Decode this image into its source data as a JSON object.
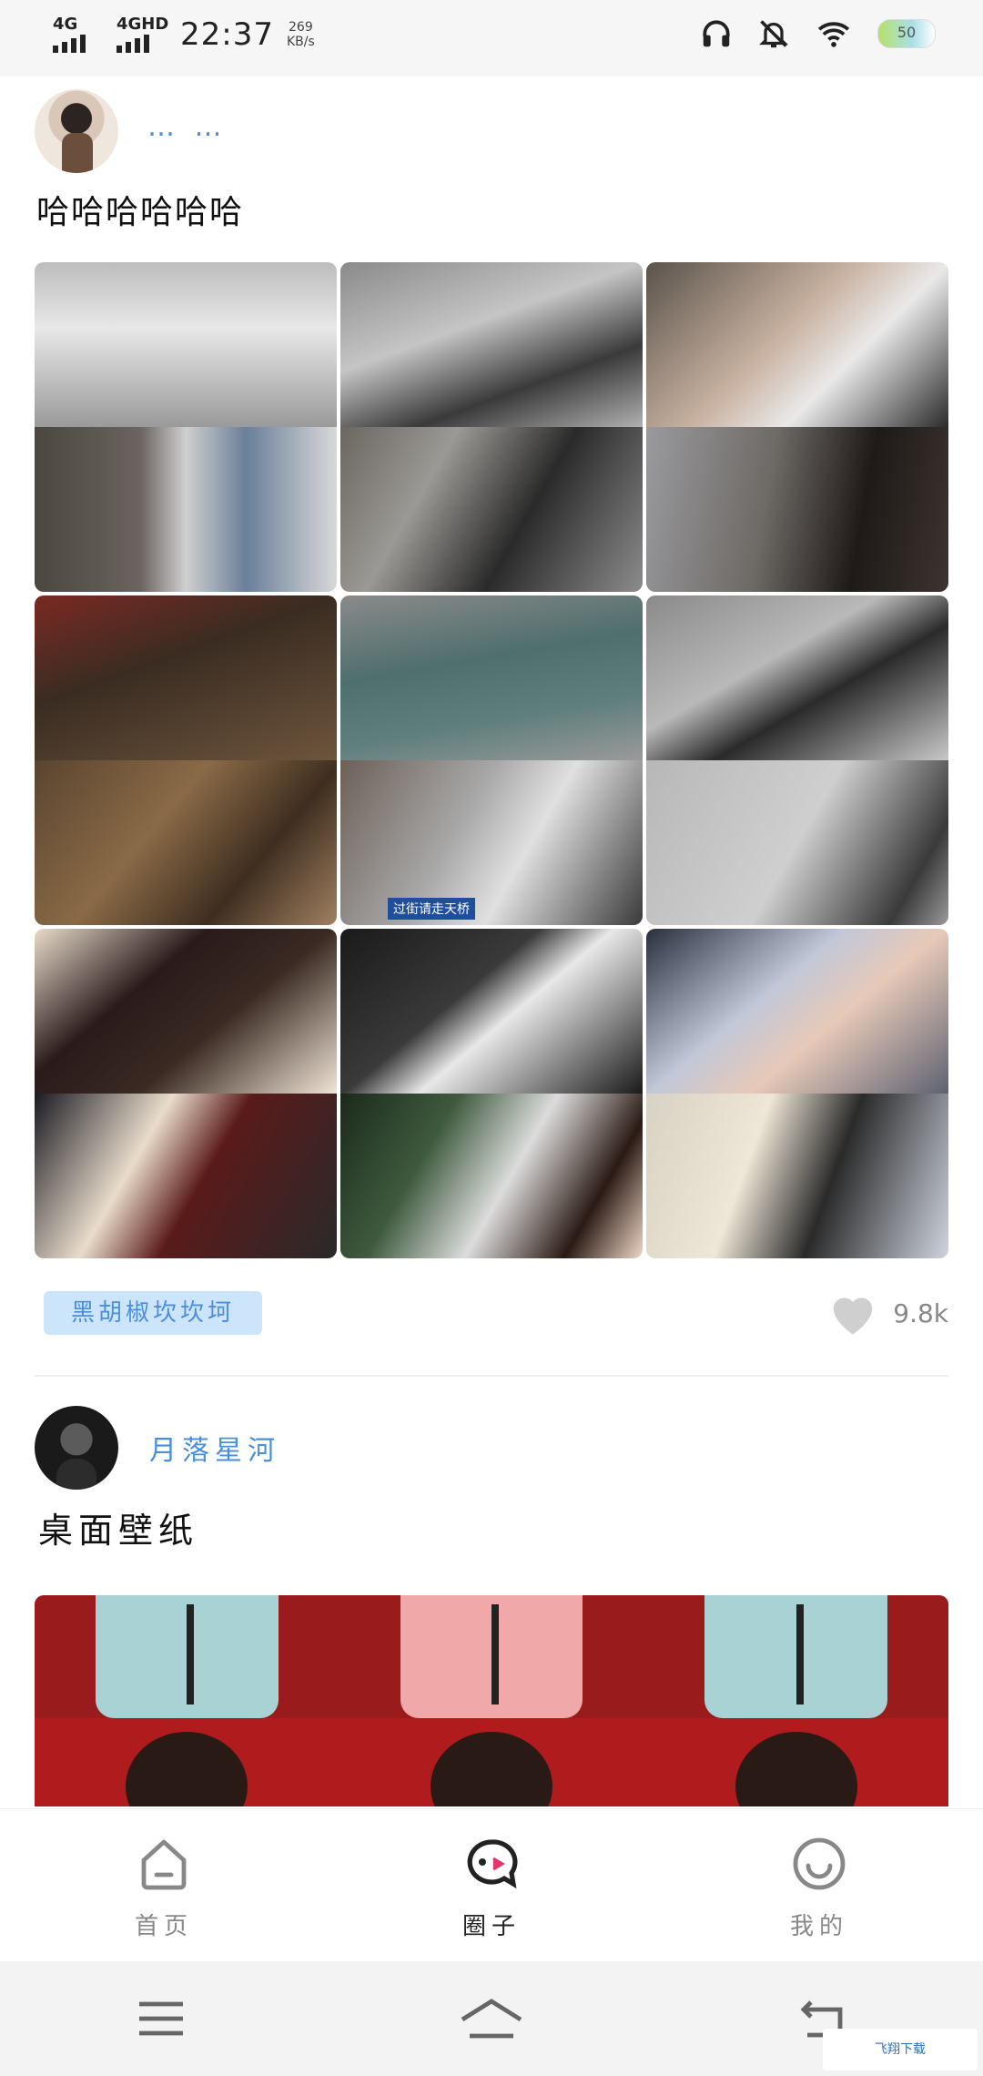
{
  "status_bar": {
    "signal_1": "4G",
    "signal_2": "4GHD",
    "time": "22:37",
    "speed_value": "269",
    "speed_unit": "KB/s",
    "battery": "50",
    "icons": [
      "headphones-icon",
      "bell-off-icon",
      "wifi-icon",
      "battery-icon"
    ]
  },
  "posts": [
    {
      "username": "…  …",
      "text": "哈哈哈哈哈哈",
      "tag": "黑胡椒坎坎坷",
      "likes": "9.8k",
      "image_count": 9
    },
    {
      "username": "月落星河",
      "text": "桌面壁纸"
    }
  ],
  "bottom_nav": {
    "items": [
      {
        "label": "首页",
        "icon": "home-icon",
        "active": false
      },
      {
        "label": "圈子",
        "icon": "circle-chat-icon",
        "active": true
      },
      {
        "label": "我的",
        "icon": "smile-profile-icon",
        "active": false
      }
    ]
  },
  "system_nav": {
    "icons": [
      "menu-icon",
      "home-outline-icon",
      "back-icon"
    ]
  },
  "watermark": "飞翔下载",
  "colors": {
    "accent": "#4a8fdc",
    "tag_bg": "#cde5fb",
    "status_bg": "#f6f6f6"
  }
}
